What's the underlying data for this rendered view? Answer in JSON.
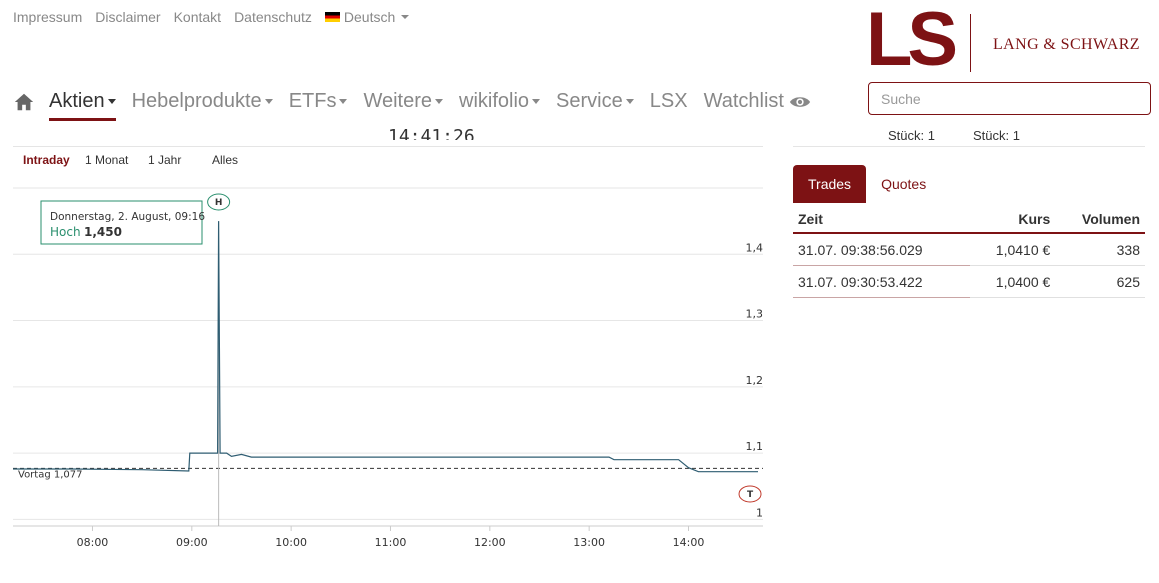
{
  "toplinks": [
    "Impressum",
    "Disclaimer",
    "Kontakt",
    "Datenschutz"
  ],
  "language": "Deutsch",
  "logo": {
    "mark": "LS",
    "name": "LANG & SCHWARZ"
  },
  "search": {
    "placeholder": "Suche"
  },
  "nav": [
    "Aktien",
    "Hebelprodukte",
    "ETFs",
    "Weitere",
    "wikifolio",
    "Service",
    "LSX",
    "Watchlist"
  ],
  "clock": "14:41:26",
  "stueck": [
    "Stück: 1",
    "Stück: 1"
  ],
  "ranges": [
    "Intraday",
    "1 Monat",
    "1 Jahr",
    "Alles"
  ],
  "tooltip": {
    "date": "Donnerstag, 2. August, 09:16",
    "label": "Hoch",
    "value": "1,450"
  },
  "markers": {
    "high": "H",
    "low": "T"
  },
  "colors": {
    "brand": "#7d1214",
    "line": "#2f5d72",
    "tooltip_accent": "#2a8f6e"
  },
  "chart_data": {
    "type": "line",
    "title": "",
    "xlabel": "",
    "ylabel": "",
    "x_ticks": [
      "08:00",
      "09:00",
      "10:00",
      "11:00",
      "12:00",
      "13:00",
      "14:00"
    ],
    "y_ticks": [
      "1",
      "1,1",
      "1,2",
      "1,3",
      "1,4"
    ],
    "xlim": [
      7.2,
      14.75
    ],
    "ylim": [
      0.99,
      1.5
    ],
    "reference": {
      "label": "Vortag 1,077",
      "value": 1.077
    },
    "high": {
      "x": 9.27,
      "y": 1.45
    },
    "low": {
      "x": 14.7,
      "y": 1.07
    },
    "x": [
      7.2,
      7.8,
      8.5,
      8.97,
      8.98,
      9.25,
      9.26,
      9.27,
      9.285,
      9.3,
      9.35,
      9.4,
      9.5,
      9.6,
      10.0,
      11.0,
      12.0,
      13.2,
      13.25,
      13.9,
      14.0,
      14.1,
      14.7
    ],
    "y": [
      1.076,
      1.076,
      1.075,
      1.073,
      1.1,
      1.1,
      1.1,
      1.45,
      1.1,
      1.1,
      1.1,
      1.095,
      1.098,
      1.094,
      1.094,
      1.094,
      1.094,
      1.094,
      1.09,
      1.09,
      1.078,
      1.072,
      1.072
    ]
  },
  "trades": {
    "tabs": [
      "Trades",
      "Quotes"
    ],
    "columns": [
      "Zeit",
      "Kurs",
      "Volumen"
    ],
    "rows": [
      [
        "31.07. 09:38:56.029",
        "1,0410 €",
        "338"
      ],
      [
        "31.07. 09:30:53.422",
        "1,0400 €",
        "625"
      ]
    ]
  }
}
